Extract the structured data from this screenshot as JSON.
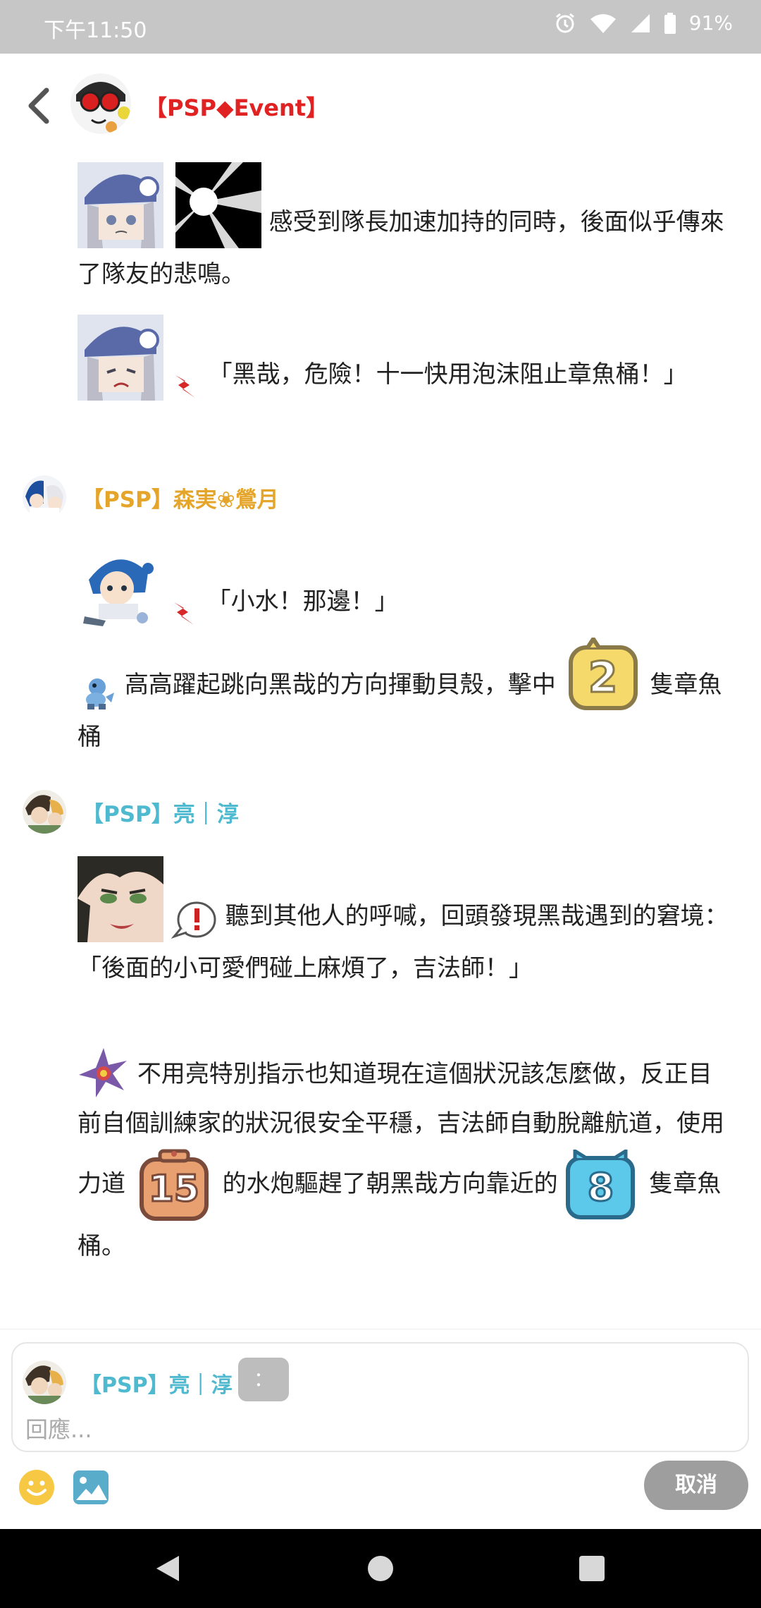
{
  "status_bar": {
    "time": "下午11:50",
    "battery": "91%"
  },
  "header": {
    "title": "【PSP◆Event】"
  },
  "posts": {
    "p1": {
      "text": "感受到隊長加速加持的同時，後面似乎傳來了隊友的悲鳴。"
    },
    "p2": {
      "text": "「黑哉，危險！十一快用泡沫阻止章魚桶！」"
    },
    "author2": {
      "name": "【PSP】森実❀鶯月"
    },
    "p3": {
      "text": "「小水！那邊！」"
    },
    "p4": {
      "text_a": "高高躍起跳向黑哉的方向揮動貝殼，擊中",
      "count": "2",
      "text_b": "隻章魚桶"
    },
    "author3": {
      "name": "【PSP】亮｜淳"
    },
    "p5": {
      "text": "聽到其他人的呼喊，回頭發現黑哉遇到的窘境：「後面的小可愛們碰上麻煩了，吉法師！」"
    },
    "p6": {
      "text_a": "不用亮特別指示也知道現在這個狀況該怎麼做，反正目前自個訓練家的狀況很安全平穩，吉法師自動脫離航道，使用力道",
      "power": "15",
      "text_b": "的水炮驅趕了朝黑哉方向靠近的",
      "count": "8",
      "text_c": "隻章魚桶。"
    }
  },
  "reply": {
    "name": "【PSP】亮｜淳",
    "chip": "：",
    "placeholder": "回應...",
    "cancel_label": "取消"
  },
  "colors": {
    "title_red": "#e02222",
    "gold": "#e5a52a",
    "teal": "#4fb9cf"
  }
}
